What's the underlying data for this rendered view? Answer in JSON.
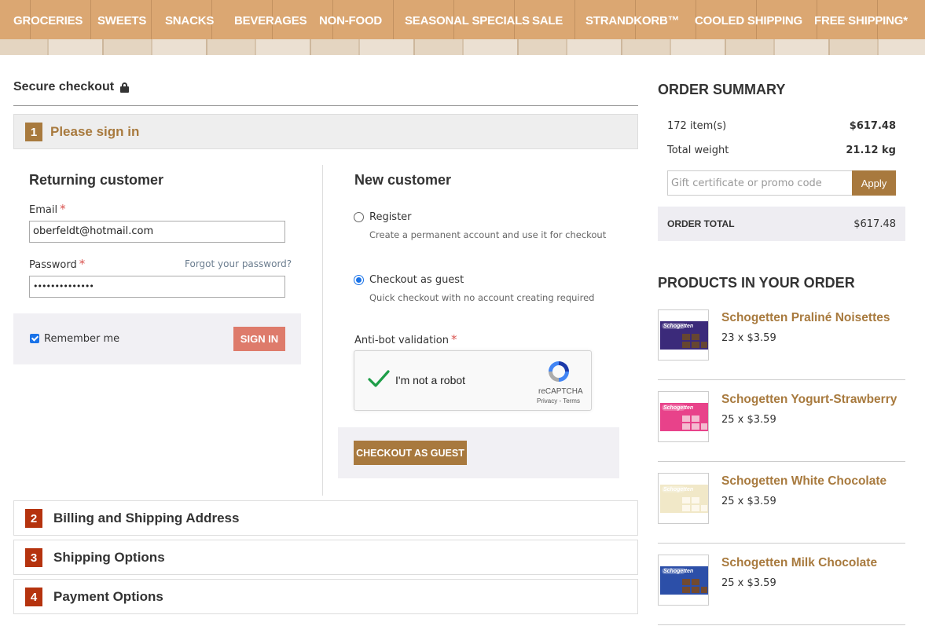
{
  "nav": {
    "items": [
      "GROCERIES",
      "SWEETS",
      "SNACKS",
      "BEVERAGES",
      "NON-FOOD",
      "SEASONAL SPECIALS",
      "SALE",
      "STRANDKORB™",
      "COOLED SHIPPING",
      "FREE SHIPPING*"
    ]
  },
  "checkout": {
    "title": "Secure checkout",
    "lock_icon": "lock-icon",
    "step1": {
      "num": "1",
      "label": "Please sign in"
    },
    "returning": {
      "heading": "Returning customer",
      "email_label": "Email",
      "email_value": "oberfeldt@hotmail.com",
      "password_label": "Password",
      "password_value": "••••••••••••••",
      "forgot": "Forgot your password?",
      "remember": "Remember me",
      "signin": "SIGN IN"
    },
    "new_customer": {
      "heading": "New customer",
      "register_label": "Register",
      "register_desc": "Create a permanent account and use it for checkout",
      "guest_label": "Checkout as guest",
      "guest_desc": "Quick checkout with no account creating required",
      "antibot_label": "Anti-bot validation",
      "recaptcha_text": "I'm not a robot",
      "recaptcha_brand": "reCAPTCHA",
      "recaptcha_terms": "Privacy - Terms",
      "guest_button": "CHECKOUT AS GUEST"
    },
    "steps": [
      {
        "num": "2",
        "label": "Billing and Shipping Address"
      },
      {
        "num": "3",
        "label": "Shipping Options"
      },
      {
        "num": "4",
        "label": "Payment Options"
      }
    ],
    "required_mark": "*"
  },
  "summary": {
    "title": "ORDER SUMMARY",
    "items_label": "172 item(s)",
    "items_value": "$617.48",
    "weight_label": "Total weight",
    "weight_value": "21.12 kg",
    "promo_placeholder": "Gift certificate or promo code",
    "apply": "Apply",
    "total_label": "ORDER TOTAL",
    "total_value": "$617.48"
  },
  "products": {
    "title": "PRODUCTS IN YOUR ORDER",
    "items": [
      {
        "name": "Schogetten Praliné Noisettes",
        "qty": "23 x $3.59",
        "color": "#3b2a7a",
        "accent": "#6b4a2a"
      },
      {
        "name": "Schogetten Yogurt-Strawberry",
        "qty": "25 x $3.59",
        "color": "#e8428a",
        "accent": "#f6c9d8"
      },
      {
        "name": "Schogetten White Chocolate",
        "qty": "25 x $3.59",
        "color": "#f1e8c8",
        "accent": "#fffaf0"
      },
      {
        "name": "Schogetten Milk Chocolate",
        "qty": "25 x $3.59",
        "color": "#2c4fa8",
        "accent": "#7a4a24"
      }
    ],
    "brand_on_pack": "Schogetten"
  },
  "colors": {
    "brand_brown": "#a87a3e",
    "step_red": "#b5330e",
    "signin_button": "#de7b6b",
    "nav_bg": "#d9a36b"
  }
}
